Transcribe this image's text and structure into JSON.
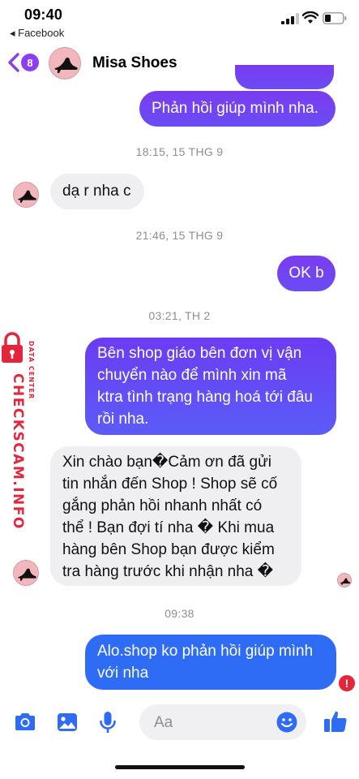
{
  "status_bar": {
    "time": "09:40",
    "back_app": "◂ Facebook"
  },
  "header": {
    "unread_count": "8",
    "contact_name": "Misa Shoes",
    "avatar_logo_text": "MISA SHOES"
  },
  "watermark": {
    "brand": "CHECKSCAM.INFO",
    "sub": "DATA CENTER"
  },
  "messages": [
    {
      "type": "outgoing",
      "text": "Phản hồi giúp mình nha."
    },
    {
      "type": "timestamp",
      "text": "18:15, 15 THG 9"
    },
    {
      "type": "incoming",
      "text": "dạ r nha c"
    },
    {
      "type": "timestamp",
      "text": "21:46, 15 THG 9"
    },
    {
      "type": "outgoing",
      "text": "OK b"
    },
    {
      "type": "timestamp",
      "text": "03:21, TH 2"
    },
    {
      "type": "outgoing",
      "lines": [
        "Bên shop giáo bên đơn vị vận",
        "chuyển nào để mình xin mã",
        "ktra tình trạng hàng hoá tới đâu",
        "rồi nha."
      ]
    },
    {
      "type": "incoming",
      "lines": [
        "Xin chào bạn�Cảm ơn đã gửi",
        "tin nhắn đến Shop ! Shop sẽ cố",
        "gắng phản hồi nhanh nhất có",
        "thể ! Bạn đợi tí nha � Khi mua",
        "hàng bên Shop bạn được kiểm",
        "tra hàng trước khi nhận nha �"
      ]
    },
    {
      "type": "timestamp",
      "text": "09:38"
    },
    {
      "type": "outgoing_failed",
      "lines": [
        "Alo.shop ko phản hồi giúp mình",
        "với nha"
      ],
      "error_mark": "!"
    }
  ],
  "composer": {
    "placeholder": "Aa"
  },
  "colors": {
    "accent_purple": "#7a3cf0",
    "accent_blue": "#2f6cf6",
    "error_red": "#e4253c",
    "watermark_red": "#e4253c"
  },
  "icons": [
    "back-chevron-icon",
    "camera-icon",
    "photo-icon",
    "microphone-icon",
    "emoji-icon",
    "like-thumb-icon",
    "error-icon",
    "signal-icon",
    "wifi-icon",
    "battery-icon"
  ]
}
